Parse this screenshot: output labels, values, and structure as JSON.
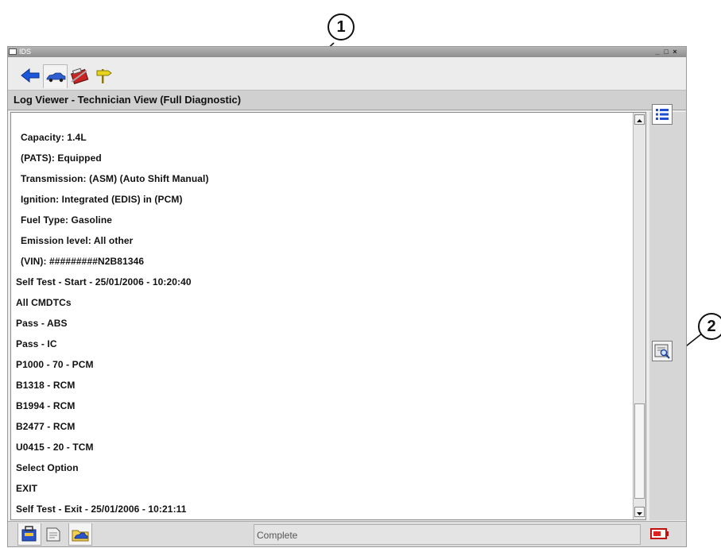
{
  "callouts": [
    "1",
    "2"
  ],
  "window": {
    "title": "IDS",
    "controls": [
      "_",
      "□",
      "×"
    ]
  },
  "tabs": [
    {
      "name": "back-arrow-icon",
      "active": false
    },
    {
      "name": "vehicle-icon",
      "active": true
    },
    {
      "name": "toolbox-icon",
      "active": false
    },
    {
      "name": "signpost-icon",
      "active": false
    }
  ],
  "header": {
    "title": "Log Viewer - Technician View (Full Diagnostic)"
  },
  "log": {
    "lines": [
      "Capacity:  1.4L",
      "(PATS):  Equipped",
      "Transmission:  (ASM) (Auto Shift Manual)",
      "Ignition:  Integrated (EDIS) in (PCM)",
      "Fuel Type:  Gasoline",
      "Emission level:  All other",
      "(VIN):  #########N2B81346",
      "Self Test - Start - 25/01/2006 - 10:20:40",
      "All CMDTCs",
      "Pass - ABS",
      "Pass - IC",
      "P1000 - 70 - PCM",
      "B1318 - RCM",
      "B1994 - RCM",
      "B2477 - RCM",
      "U0415 - 20 - TCM",
      "Select Option",
      "EXIT",
      "Self Test - Exit - 25/01/2006 - 10:21:11"
    ]
  },
  "side_buttons": [
    "list-view-icon",
    "log-search-icon"
  ],
  "bottom": {
    "tabs": [
      "toolbox-icon",
      "document-icon",
      "vehicle-folder-icon"
    ],
    "status": "Complete",
    "battery_icon": "battery-icon"
  }
}
